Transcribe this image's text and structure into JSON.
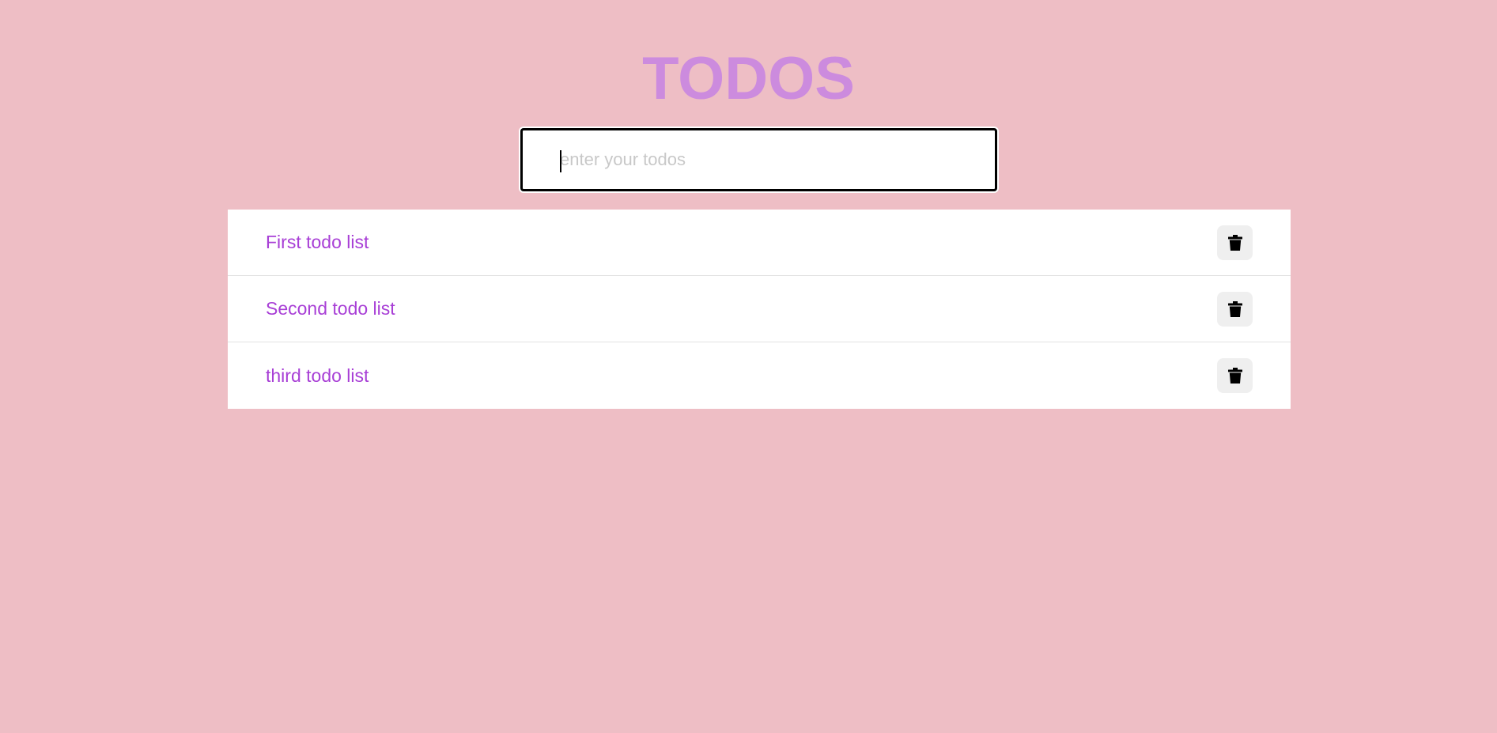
{
  "header": {
    "title": "TODOS"
  },
  "input": {
    "placeholder": "enter your todos",
    "value": ""
  },
  "todos": [
    {
      "text": "First todo list",
      "delete_icon": "trash-icon"
    },
    {
      "text": "Second todo list",
      "delete_icon": "trash-icon"
    },
    {
      "text": "third todo list",
      "delete_icon": "trash-icon"
    }
  ],
  "colors": {
    "background": "#eebec5",
    "title": "#cc8bde",
    "todo_text": "#a83fd6",
    "delete_button_bg": "#efefef"
  }
}
